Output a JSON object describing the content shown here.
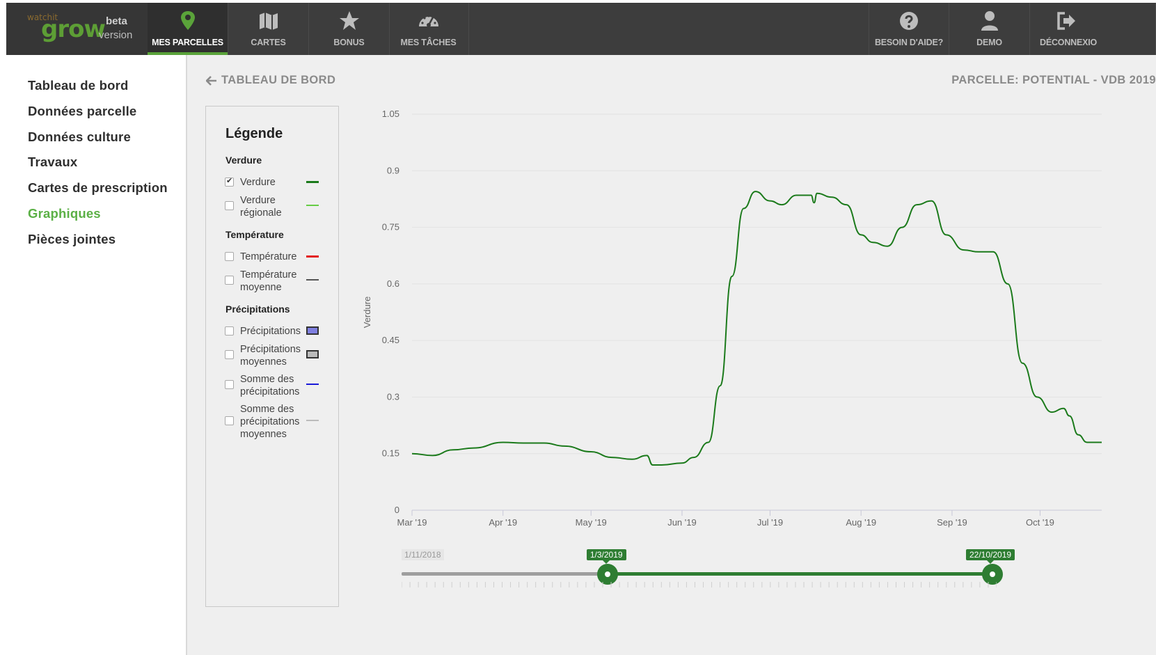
{
  "brand": {
    "watch": "watchit",
    "grow": "grow",
    "beta": "beta",
    "version": "version",
    "accent": "#5aa33a"
  },
  "nav": {
    "items": [
      {
        "label": "MES PARCELLES",
        "icon": "map-pin-icon",
        "active": true
      },
      {
        "label": "CARTES",
        "icon": "map-icon",
        "active": false
      },
      {
        "label": "BONUS",
        "icon": "star-icon",
        "active": false
      },
      {
        "label": "MES TÂCHES",
        "icon": "dashboard-icon",
        "active": false
      }
    ],
    "right": [
      {
        "label": "BESOIN D'AIDE?",
        "icon": "question-circle-icon"
      },
      {
        "label": "DEMO",
        "icon": "user-icon"
      },
      {
        "label": "DÉCONNEXIO",
        "icon": "logout-icon"
      }
    ]
  },
  "sidebar": {
    "items": [
      {
        "label": "Tableau de bord",
        "active": false
      },
      {
        "label": "Données parcelle",
        "active": false
      },
      {
        "label": "Données culture",
        "active": false
      },
      {
        "label": "Travaux",
        "active": false
      },
      {
        "label": "Cartes de prescription",
        "active": false
      },
      {
        "label": "Graphiques",
        "active": true
      },
      {
        "label": "Pièces jointes",
        "active": false
      }
    ],
    "active_color": "#5bb046"
  },
  "header": {
    "back_label": "TABLEAU DE BORD",
    "parcel_title": "PARCELLE: POTENTIAL - VDB 2019"
  },
  "legend": {
    "title": "Légende",
    "groups": [
      {
        "name": "Verdure",
        "items": [
          {
            "label": "Verdure",
            "checked": true,
            "swatch": "line",
            "color": "#1b7a1b"
          },
          {
            "label": "Verdure régionale",
            "checked": false,
            "swatch": "line",
            "color": "#66cc44"
          }
        ]
      },
      {
        "name": "Température",
        "items": [
          {
            "label": "Température",
            "checked": false,
            "swatch": "line",
            "color": "#e31b1b"
          },
          {
            "label": "Température moyenne",
            "checked": false,
            "swatch": "line",
            "color": "#555555"
          }
        ]
      },
      {
        "name": "Précipitations",
        "items": [
          {
            "label": "Précipitations",
            "checked": false,
            "swatch": "box",
            "color": "#7f7fe0"
          },
          {
            "label": "Précipitations moyennes",
            "checked": false,
            "swatch": "box",
            "color": "#bbbbbb"
          },
          {
            "label": "Somme des précipitations",
            "checked": false,
            "swatch": "line",
            "color": "#1a1ad8"
          },
          {
            "label": "Somme des précipitations moyennes",
            "checked": false,
            "swatch": "line",
            "color": "#bbbbbb"
          }
        ]
      }
    ]
  },
  "chart_data": {
    "type": "line",
    "title": "",
    "xlabel": "",
    "ylabel": "Verdure",
    "ylim": [
      0,
      1.05
    ],
    "yticks": [
      "0",
      "0.15",
      "0.3",
      "0.45",
      "0.6",
      "0.75",
      "0.9",
      "1.05"
    ],
    "xticks": [
      "Mar '19",
      "Apr '19",
      "May '19",
      "Jun '19",
      "Jul '19",
      "Aug '19",
      "Sep '19",
      "Oct '19"
    ],
    "grid": true,
    "series": [
      {
        "name": "Verdure",
        "color": "#1b7a1b",
        "x": [
          "2019-03-01",
          "2019-03-08",
          "2019-03-15",
          "2019-03-22",
          "2019-04-01",
          "2019-04-08",
          "2019-04-15",
          "2019-04-22",
          "2019-05-01",
          "2019-05-08",
          "2019-05-15",
          "2019-05-20",
          "2019-05-22",
          "2019-05-23",
          "2019-05-25",
          "2019-06-01",
          "2019-06-05",
          "2019-06-10",
          "2019-06-14",
          "2019-06-18",
          "2019-06-22",
          "2019-06-26",
          "2019-07-01",
          "2019-07-05",
          "2019-07-10",
          "2019-07-15",
          "2019-07-16",
          "2019-07-17",
          "2019-07-22",
          "2019-07-27",
          "2019-08-01",
          "2019-08-05",
          "2019-08-10",
          "2019-08-15",
          "2019-08-20",
          "2019-08-25",
          "2019-08-30",
          "2019-09-05",
          "2019-09-10",
          "2019-09-15",
          "2019-09-20",
          "2019-09-25",
          "2019-09-30",
          "2019-10-05",
          "2019-10-09",
          "2019-10-11",
          "2019-10-14",
          "2019-10-17",
          "2019-10-22"
        ],
        "values": [
          0.15,
          0.145,
          0.16,
          0.165,
          0.18,
          0.178,
          0.178,
          0.17,
          0.155,
          0.14,
          0.135,
          0.145,
          0.12,
          0.12,
          0.12,
          0.125,
          0.14,
          0.18,
          0.33,
          0.62,
          0.8,
          0.845,
          0.82,
          0.81,
          0.835,
          0.835,
          0.815,
          0.84,
          0.83,
          0.81,
          0.73,
          0.71,
          0.7,
          0.75,
          0.81,
          0.82,
          0.73,
          0.69,
          0.685,
          0.685,
          0.6,
          0.39,
          0.3,
          0.26,
          0.27,
          0.25,
          0.2,
          0.18,
          0.18
        ]
      }
    ]
  },
  "range": {
    "start_label": "1/11/2018",
    "from_label": "1/3/2019",
    "to_label": "22/10/2019",
    "from_fraction": 0.346,
    "to_fraction": 0.993,
    "color": "#2e7d32"
  }
}
